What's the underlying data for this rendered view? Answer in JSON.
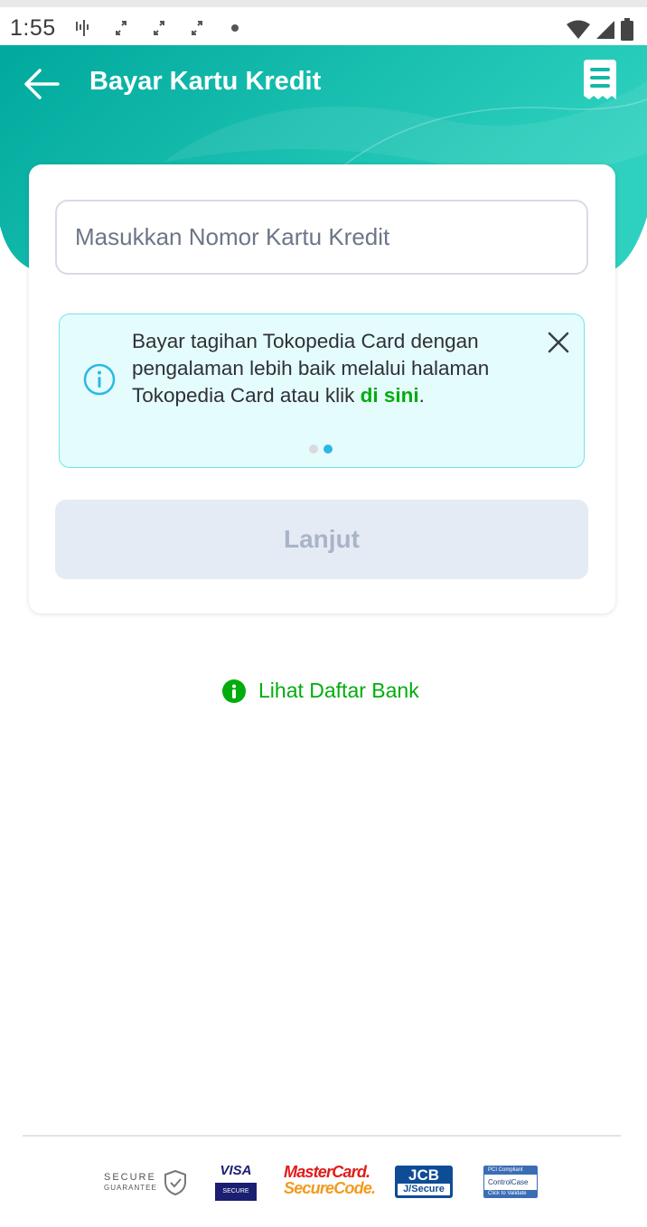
{
  "status_bar": {
    "time": "1:55",
    "left_icons": [
      "signal-activity-icon",
      "sync-icon",
      "sync-icon",
      "sync-icon",
      "dot-icon"
    ],
    "right_icons": [
      "wifi-icon",
      "cellular-icon",
      "battery-icon"
    ]
  },
  "header": {
    "title": "Bayar Kartu Kredit",
    "back_icon": "arrow-left-icon",
    "action_icon": "receipt-icon",
    "gradient": [
      "#00a99d",
      "#2ed1bf"
    ]
  },
  "form": {
    "card_number_placeholder": "Masukkan Nomor Kartu Kredit",
    "card_number_value": "",
    "submit_label": "Lanjut"
  },
  "ticker": {
    "text_before_link": "Bayar tagihan Tokopedia Card dengan pengalaman lebih baik melalui halaman Tokopedia Card atau klik ",
    "link_text": "di sini",
    "text_after_link": ".",
    "icon": "info-icon",
    "close_icon": "close-icon",
    "page_count": 2,
    "active_page": 2
  },
  "bank_list": {
    "label": "Lihat Daftar Bank",
    "icon": "info-filled-icon"
  },
  "footer": {
    "secure_guarantee": {
      "line1": "SECURE",
      "line2": "GUARANTEE",
      "icon": "shield-check-icon"
    },
    "visa": {
      "brand": "VISA",
      "sub": "SECURE"
    },
    "mastercard": {
      "line1": "MasterCard.",
      "line2": "SecureCode."
    },
    "jcb": {
      "brand": "JCB",
      "sub": "J/Secure"
    },
    "pci": {
      "line1": "PCI Compliant",
      "line2": "ControlCase",
      "line3": "Click to Validate"
    }
  },
  "colors": {
    "brand_green": "#03ac0e",
    "ticker_bg": "#e5fcfd",
    "ticker_border": "#77e0eb",
    "button_disabled_bg": "#e4ebf5",
    "button_disabled_text": "#aab4c8"
  }
}
